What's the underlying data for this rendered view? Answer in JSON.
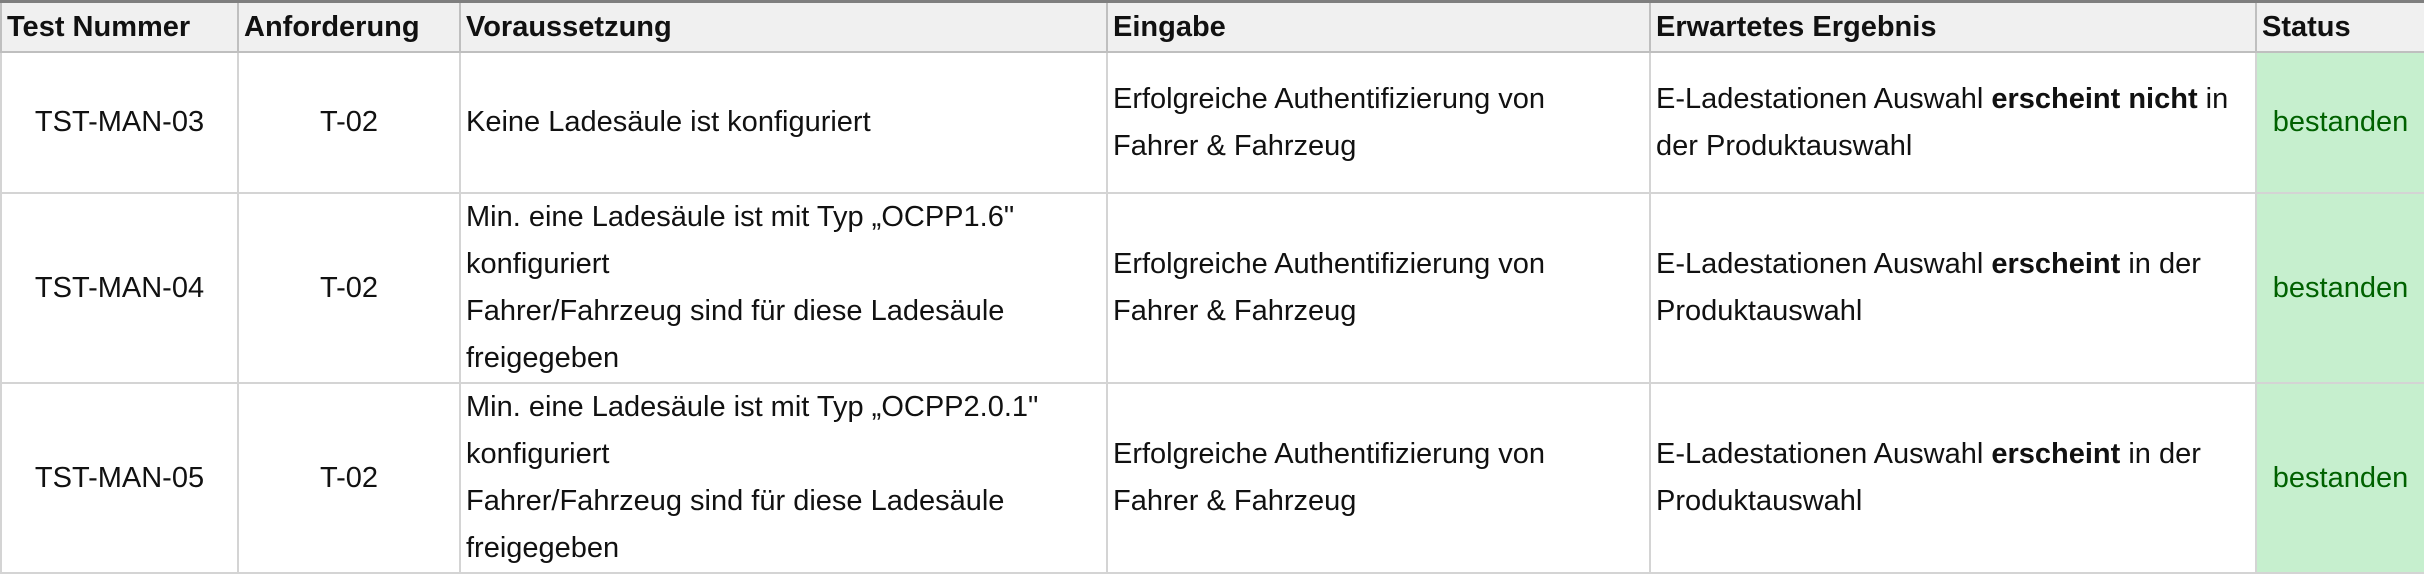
{
  "headers": [
    "Test Nummer",
    "Anforderung",
    "Voraussetzung",
    "Eingabe",
    "Erwartetes Ergebnis",
    "Status"
  ],
  "rows": [
    {
      "test": "TST-MAN-03",
      "req": "T-02",
      "pre": [
        "Keine Ladesäule ist konfiguriert"
      ],
      "input": [
        "Erfolgreiche Authentifizierung von",
        "Fahrer & Fahrzeug"
      ],
      "result": {
        "before": "E-Ladestationen Auswahl ",
        "bold": "erscheint nicht",
        "after": " in der Produktauswahl"
      },
      "status": "bestanden"
    },
    {
      "test": "TST-MAN-04",
      "req": "T-02",
      "pre": [
        "Min. eine Ladesäule ist mit Typ „OCPP1.6\"",
        "konfiguriert",
        "Fahrer/Fahrzeug sind für diese Ladesäule",
        "freigegeben"
      ],
      "input": [
        "Erfolgreiche Authentifizierung von",
        "Fahrer & Fahrzeug"
      ],
      "result": {
        "before": "E-Ladestationen Auswahl ",
        "bold": "erscheint",
        "after": " in der Produktauswahl"
      },
      "status": "bestanden"
    },
    {
      "test": "TST-MAN-05",
      "req": "T-02",
      "pre": [
        "Min. eine Ladesäule ist mit Typ „OCPP2.0.1\"",
        "konfiguriert",
        "Fahrer/Fahrzeug sind für diese Ladesäule",
        "freigegeben"
      ],
      "input": [
        "Erfolgreiche Authentifizierung von",
        "Fahrer & Fahrzeug"
      ],
      "result": {
        "before": "E-Ladestationen Auswahl ",
        "bold": "erscheint",
        "after": " in der Produktauswahl"
      },
      "status": "bestanden"
    }
  ]
}
